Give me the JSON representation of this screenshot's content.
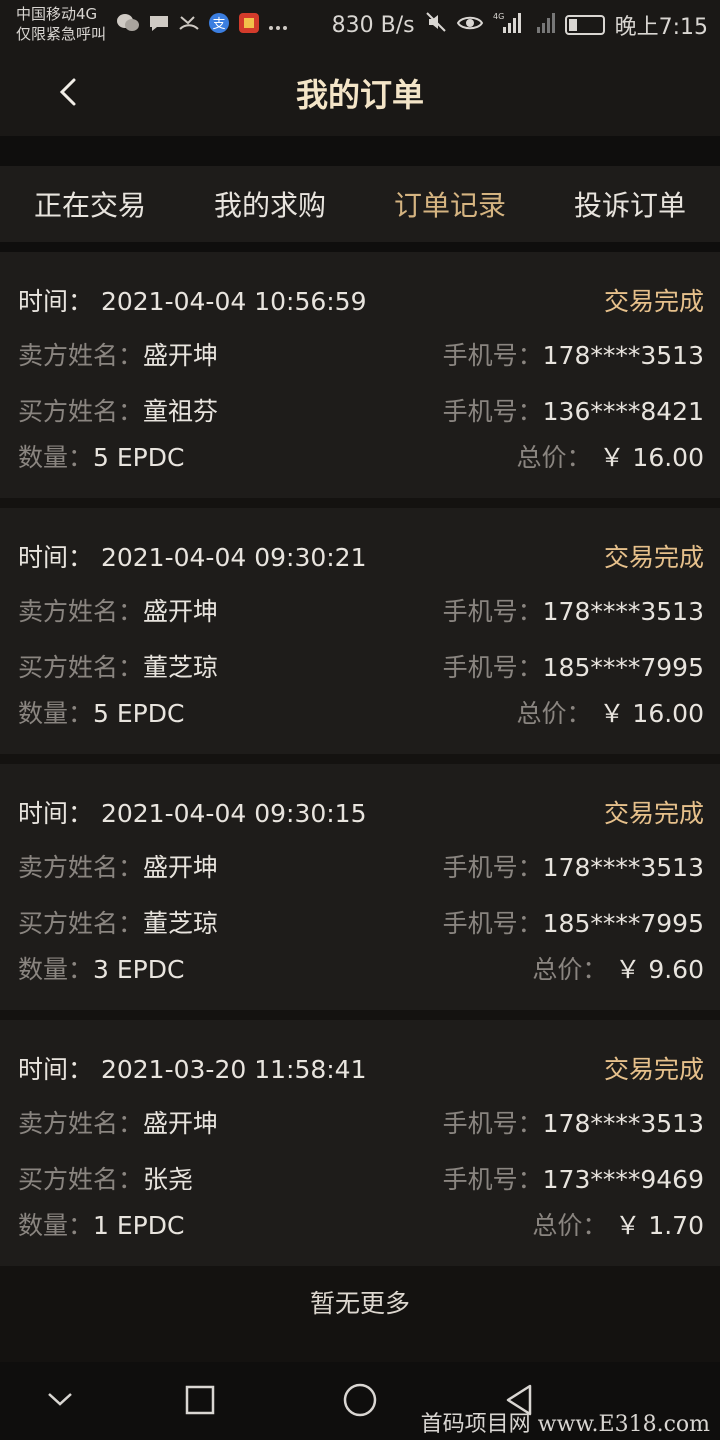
{
  "status_bar": {
    "carrier_line1": "中国移动4G",
    "carrier_line2": "仅限紧急呼叫",
    "app_icons": [
      "wechat-icon",
      "chat-icon",
      "missed-call-icon",
      "alipay-icon",
      "app-icon",
      "more-icon"
    ],
    "net_speed": "830 B/s",
    "time": "晚上7:15"
  },
  "header": {
    "title": "我的订单"
  },
  "tabs": [
    {
      "label": "正在交易"
    },
    {
      "label": "我的求购"
    },
    {
      "label": "订单记录"
    },
    {
      "label": "投诉订单"
    }
  ],
  "active_tab": "订单记录",
  "labels": {
    "time": "时间：",
    "seller": "卖方姓名：",
    "buyer": "买方姓名：",
    "phone": "手机号：",
    "quantity": "数量：",
    "total": "总价："
  },
  "orders": [
    {
      "time": "2021-04-04 10:56:59",
      "status": "交易完成",
      "seller": "盛开坤",
      "seller_phone": "178****3513",
      "buyer": "童祖芬",
      "buyer_phone": "136****8421",
      "quantity": "5 EPDC",
      "total": "￥ 16.00"
    },
    {
      "time": "2021-04-04 09:30:21",
      "status": "交易完成",
      "seller": "盛开坤",
      "seller_phone": "178****3513",
      "buyer": "董芝琼",
      "buyer_phone": "185****7995",
      "quantity": "5 EPDC",
      "total": "￥ 16.00"
    },
    {
      "time": "2021-04-04 09:30:15",
      "status": "交易完成",
      "seller": "盛开坤",
      "seller_phone": "178****3513",
      "buyer": "董芝琼",
      "buyer_phone": "185****7995",
      "quantity": "3 EPDC",
      "total": "￥ 9.60"
    },
    {
      "time": "2021-03-20 11:58:41",
      "status": "交易完成",
      "seller": "盛开坤",
      "seller_phone": "178****3513",
      "buyer": "张尧",
      "buyer_phone": "173****9469",
      "quantity": "1 EPDC",
      "total": "￥ 1.70"
    }
  ],
  "footer_text": "暂无更多",
  "watermark": "首码项目网  www.E318.com",
  "colors": {
    "accent_gold": "#d5b481",
    "status_gold": "#e6c08b",
    "title_cream": "#f4e5c8",
    "card_bg": "#1e1c1a",
    "page_bg": "#0f0e0d"
  }
}
